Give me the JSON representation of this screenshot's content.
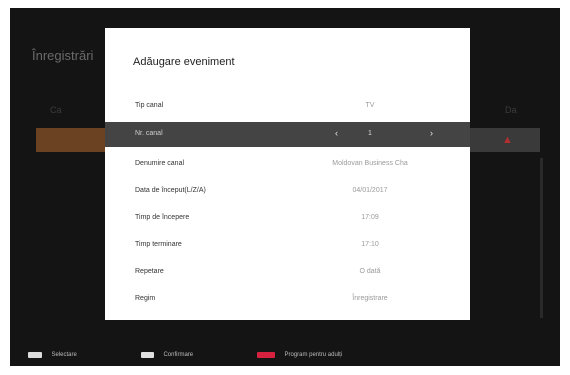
{
  "background": {
    "page_title": "Înregistrări",
    "column_left": "Ca",
    "column_right": "Da"
  },
  "dialog": {
    "title": "Adăugare eveniment",
    "rows": [
      {
        "label": "Tip canal",
        "value": "TV"
      },
      {
        "label": "Nr. canal",
        "value": "1"
      },
      {
        "label": "Denumire canal",
        "value": "Moldovan Business Cha"
      },
      {
        "label": "Data de început(L/Z/A)",
        "value": "04/01/2017"
      },
      {
        "label": "Timp de începere",
        "value": "17:09"
      },
      {
        "label": "Timp terminare",
        "value": "17:10"
      },
      {
        "label": "Repetare",
        "value": "O dată"
      },
      {
        "label": "Regim",
        "value": "Înregistrare"
      }
    ],
    "selected_row": "Nr. canal",
    "arrow_left": "‹",
    "arrow_right": "›"
  },
  "footer": {
    "select": "Selectare",
    "confirm": "Confirmare",
    "adult": "Program pentru adulți"
  },
  "colors": {
    "screen_bg": "#141414",
    "dialog_bg": "#ffffff",
    "selected_row": "#444444",
    "red_key": "#d6213f",
    "background_highlight": "#6b4322"
  }
}
